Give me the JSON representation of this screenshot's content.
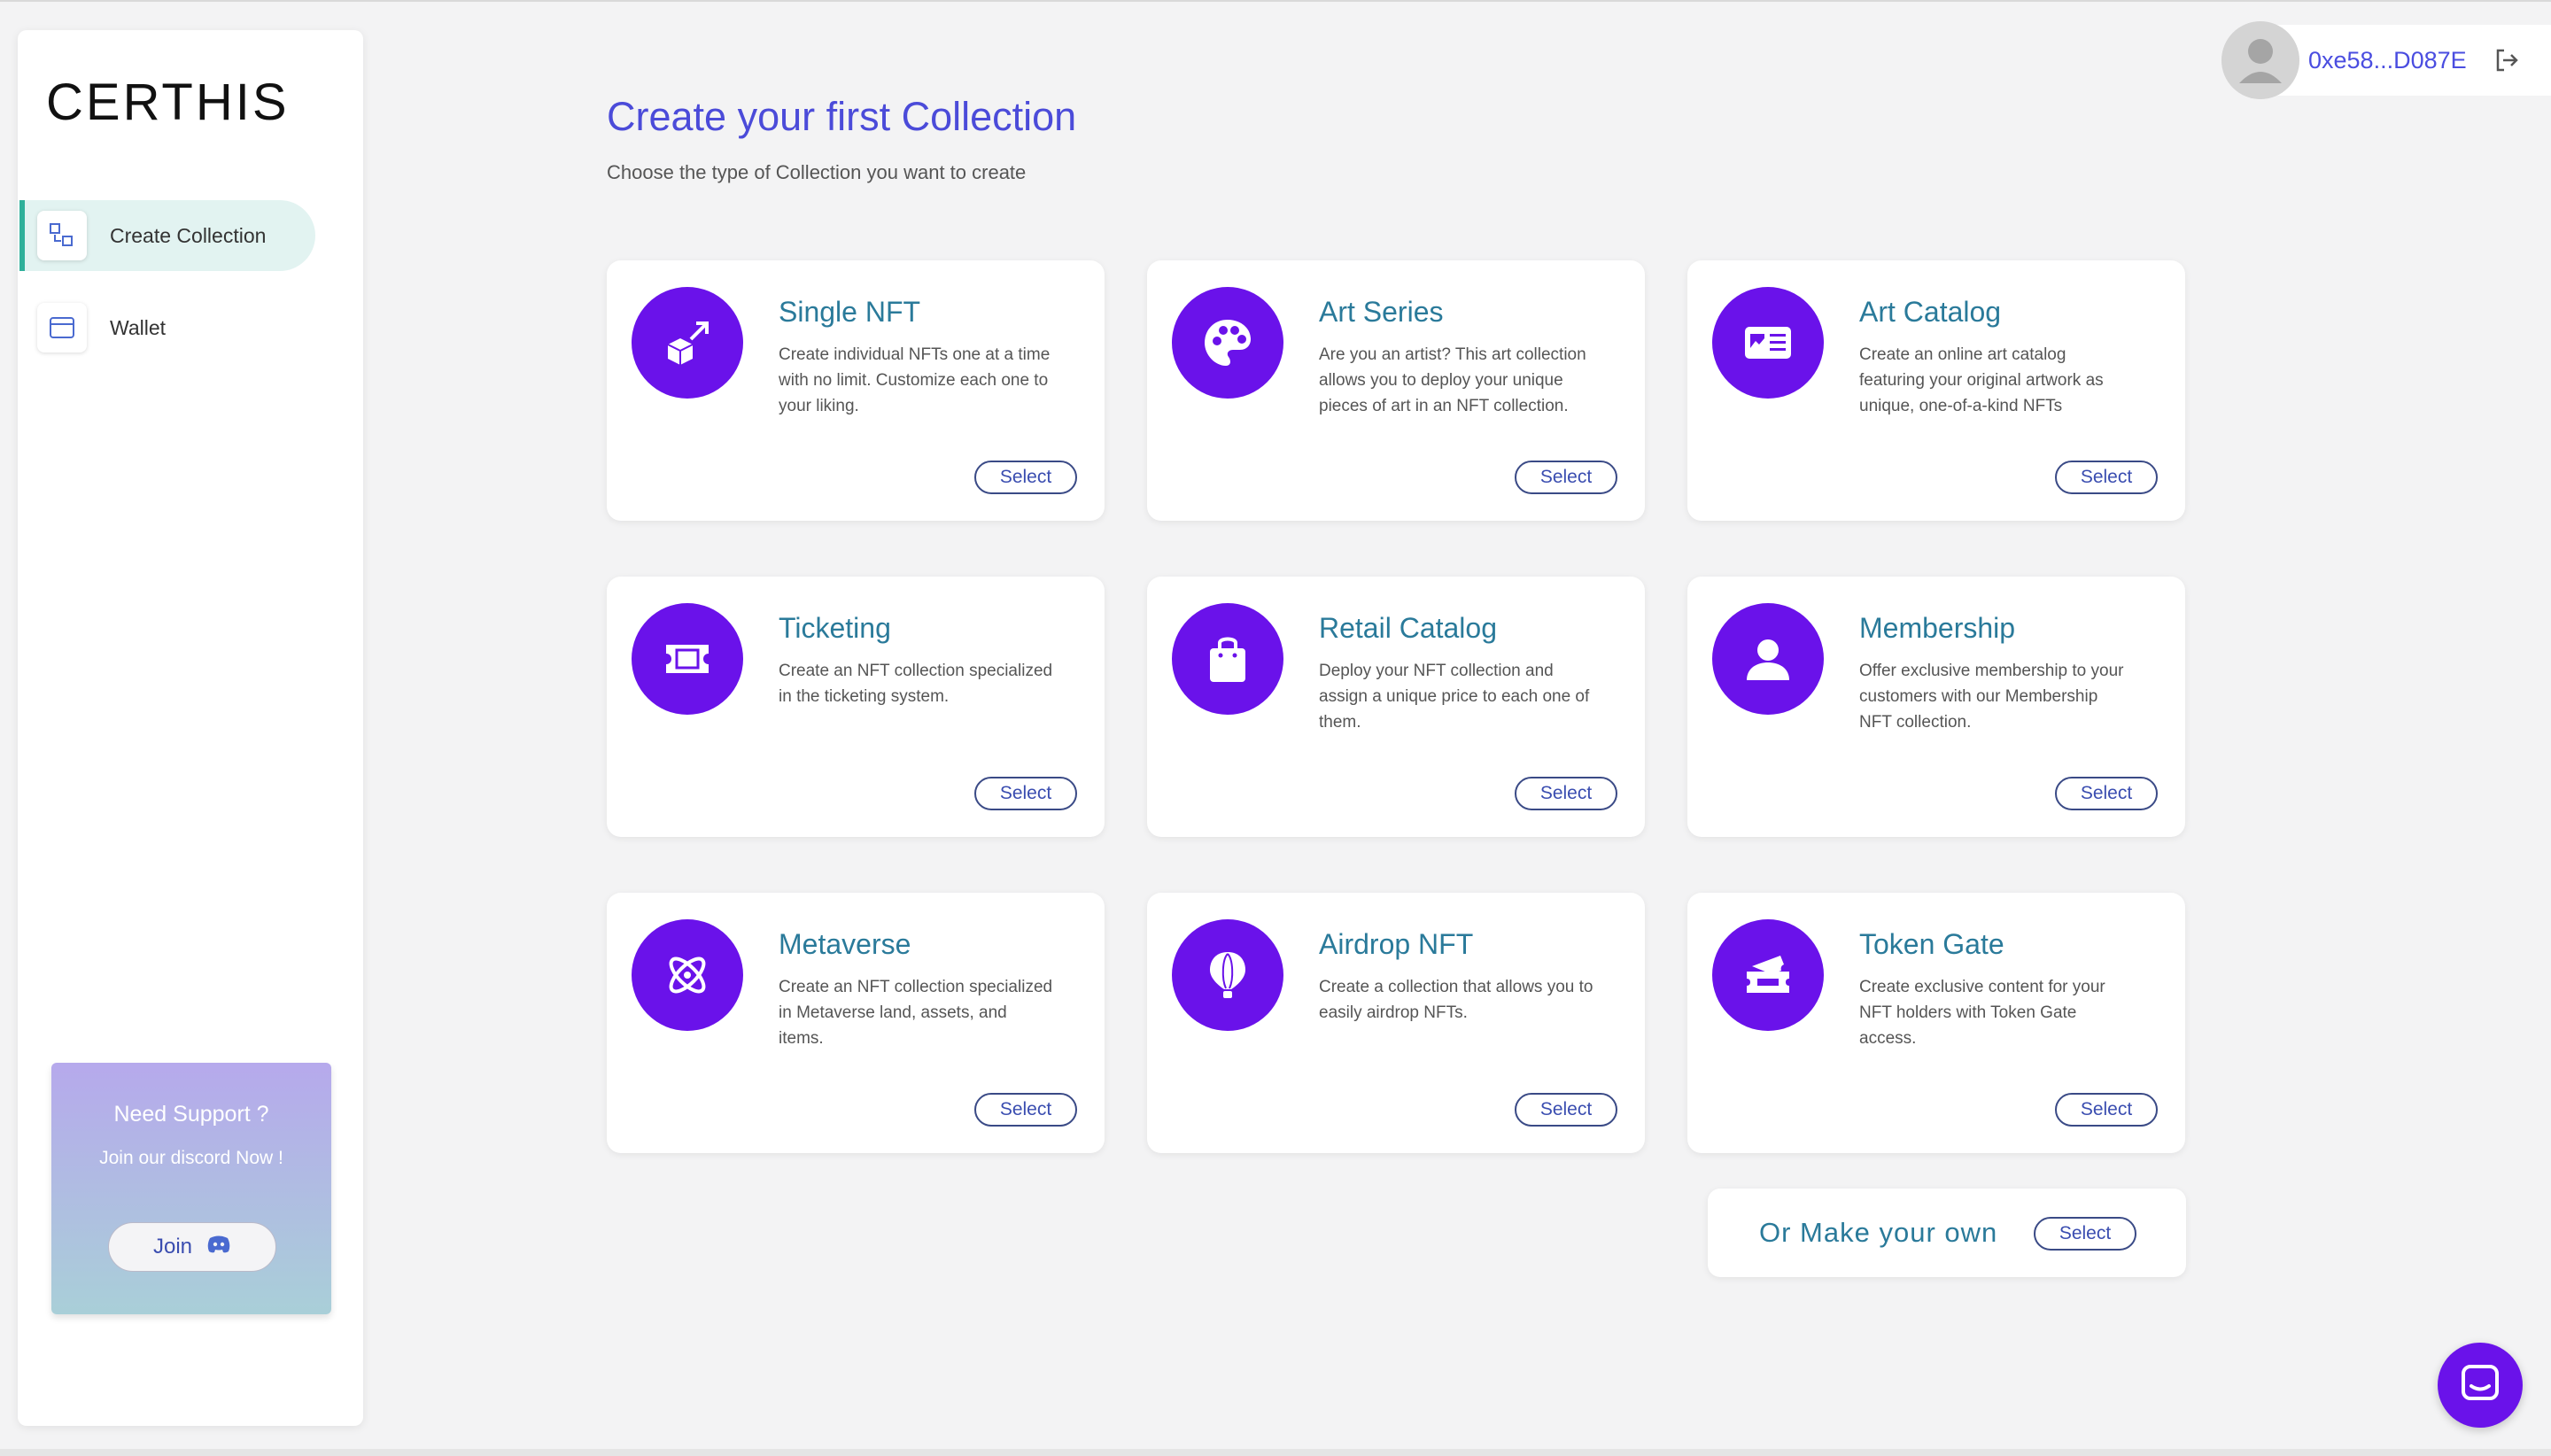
{
  "brand": {
    "logo": "CERTHIS"
  },
  "sidebar": {
    "items": [
      {
        "label": "Create Collection",
        "icon": "collection-icon",
        "active": true
      },
      {
        "label": "Wallet",
        "icon": "wallet-icon",
        "active": false
      }
    ],
    "support": {
      "title": "Need Support ?",
      "subtitle": "Join our discord Now !",
      "join_label": "Join"
    }
  },
  "header": {
    "wallet_address": "0xe58...D087E"
  },
  "main": {
    "title": "Create your first Collection",
    "subtitle": "Choose the type of Collection you want to create",
    "cards": [
      {
        "title": "Single NFT",
        "description": "Create individual NFTs one at a time with no limit. Customize each one to your liking.",
        "icon": "cube-arrow-icon",
        "select_label": "Select"
      },
      {
        "title": "Art Series",
        "description": "Are you an artist? This art collection allows you to deploy your unique pieces of art in an NFT collection.",
        "icon": "palette-icon",
        "select_label": "Select"
      },
      {
        "title": "Art Catalog",
        "description": "Create an online art catalog featuring your original artwork as unique, one-of-a-kind NFTs",
        "icon": "catalog-card-icon",
        "select_label": "Select"
      },
      {
        "title": "Ticketing",
        "description": "Create an NFT collection specialized in the ticketing system.",
        "icon": "ticket-icon",
        "select_label": "Select"
      },
      {
        "title": "Retail Catalog",
        "description": "Deploy your NFT collection and assign a unique price to each one of them.",
        "icon": "shopping-bag-icon",
        "select_label": "Select"
      },
      {
        "title": "Membership",
        "description": "Offer exclusive membership to your customers with our Membership NFT collection.",
        "icon": "user-icon",
        "select_label": "Select"
      },
      {
        "title": "Metaverse",
        "description": "Create an NFT collection specialized in Metaverse land, assets, and items.",
        "icon": "atom-icon",
        "select_label": "Select"
      },
      {
        "title": "Airdrop NFT",
        "description": "Create a collection that allows you to easily airdrop NFTs.",
        "icon": "hot-air-balloon-icon",
        "select_label": "Select"
      },
      {
        "title": "Token Gate",
        "description": "Create exclusive content for your NFT holders with Token Gate access.",
        "icon": "tickets-icon",
        "select_label": "Select"
      }
    ],
    "custom": {
      "label": "Or Make your own",
      "select_label": "Select"
    }
  },
  "colors": {
    "accent": "#6a12ea",
    "title": "#4b4bd9",
    "card_title": "#2a7a9a",
    "active_bg": "#e2f3f1",
    "active_border": "#2fb09a"
  }
}
